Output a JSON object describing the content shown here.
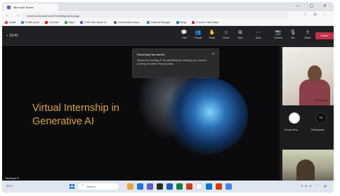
{
  "browser": {
    "tab_title": "Microsoft Teams",
    "window_controls": "— ▢ ✕",
    "nav": "← → ↻",
    "url": "teams.microsoft.com/?meetings-join-page",
    "extensions": "☆ ⊕ ⋮",
    "bookmarks": [
      {
        "label": "Gmail",
        "color": "#ea4335"
      },
      {
        "label": "Profile photo",
        "color": "#4285f4"
      },
      {
        "label": "YouTube",
        "color": "#ff0000"
      },
      {
        "label": "Maps",
        "color": "#34a853"
      },
      {
        "label": "ICSE Tech News To...",
        "color": "#5b5fc7"
      },
      {
        "label": "Conversation about...",
        "color": "#6b6b6b"
      },
      {
        "label": "Editorial Manager",
        "color": "#4285f4"
      },
      {
        "label": "Blogs",
        "color": "#1a73e8"
      },
      {
        "label": "Found in Tamil Nadu",
        "color": "#c4314b"
      }
    ]
  },
  "meeting": {
    "timer": "16:41",
    "tools": [
      {
        "glyph": "💬",
        "label": "Chat"
      },
      {
        "glyph": "👥",
        "label": "People"
      },
      {
        "glyph": "✋",
        "label": "Raise"
      },
      {
        "glyph": "☺",
        "label": "React"
      },
      {
        "glyph": "⊞",
        "label": "View"
      },
      {
        "glyph": "⋯",
        "label": "More"
      },
      {
        "glyph": "📷",
        "label": "Camera"
      },
      {
        "glyph": "🎙",
        "label": "Mic"
      },
      {
        "glyph": "⇪",
        "label": "Share"
      }
    ],
    "leave_label": "Leave"
  },
  "toast": {
    "title": "Recording has started.",
    "body": "Started by Sandhya R. By attending this meeting, you consent to being recorded. Privacy policy",
    "close": "✕"
  },
  "slide": {
    "line1": "Virtual Internship in",
    "line2": "Generative AI",
    "title_color": "#d9a441",
    "presenter": "Sandhya R"
  },
  "participants": {
    "top_name": "Eva Agarwal",
    "mid_left_label": "Pravan Sha...",
    "mid_right_initials": "TK",
    "mid_right_label": "Participants"
  },
  "taskbar": {
    "weather": "31°C",
    "search_placeholder": "Search",
    "tray": "ENG ⌃ 🔊"
  }
}
